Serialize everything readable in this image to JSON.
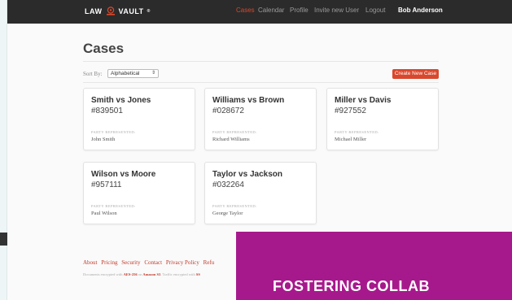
{
  "header": {
    "logo_left": "LAW",
    "logo_right": "VAULT",
    "logo_mark": "®",
    "nav": [
      {
        "label": "Cases",
        "active": true
      },
      {
        "label": "Calendar",
        "active": false
      },
      {
        "label": "Profile",
        "active": false
      },
      {
        "label": "Invite new User",
        "active": false
      },
      {
        "label": "Logout",
        "active": false
      }
    ],
    "user_name": "Bob Anderson"
  },
  "page": {
    "title": "Cases",
    "sort_label": "Sort By:",
    "sort_value": "Alphabetical",
    "create_button": "Create New Case"
  },
  "cases": [
    {
      "name": "Smith vs Jones",
      "number": "#839501",
      "party_label": "PARTY REPRESENTED:",
      "party": "John Smith"
    },
    {
      "name": "Williams vs Brown",
      "number": "#028672",
      "party_label": "PARTY REPRESENTED:",
      "party": "Richard Williams"
    },
    {
      "name": "Miller vs Davis",
      "number": "#927552",
      "party_label": "PARTY REPRESENTED:",
      "party": "Michael Miller"
    },
    {
      "name": "Wilson vs Moore",
      "number": "#957111",
      "party_label": "PARTY REPRESENTED:",
      "party": "Paul Wilson"
    },
    {
      "name": "Taylor vs Jackson",
      "number": "#032264",
      "party_label": "PARTY REPRESENTED:",
      "party": "George Taylor"
    }
  ],
  "footer": {
    "links": [
      "About",
      "Pricing",
      "Security",
      "Contact",
      "Privacy Policy",
      "Refu"
    ],
    "note_1": "Documents encrypted with ",
    "note_aes": "AES-256",
    "note_2": " on ",
    "note_s3": "Amazon S3",
    "note_3": ". Traffic encrypted with ",
    "note_ssl": "SS"
  },
  "promo": {
    "text": "FOSTERING COLLAB"
  },
  "colors": {
    "accent": "#d9482c",
    "promo_bg": "#a6198c",
    "topbar_bg": "#2b2b2b"
  }
}
